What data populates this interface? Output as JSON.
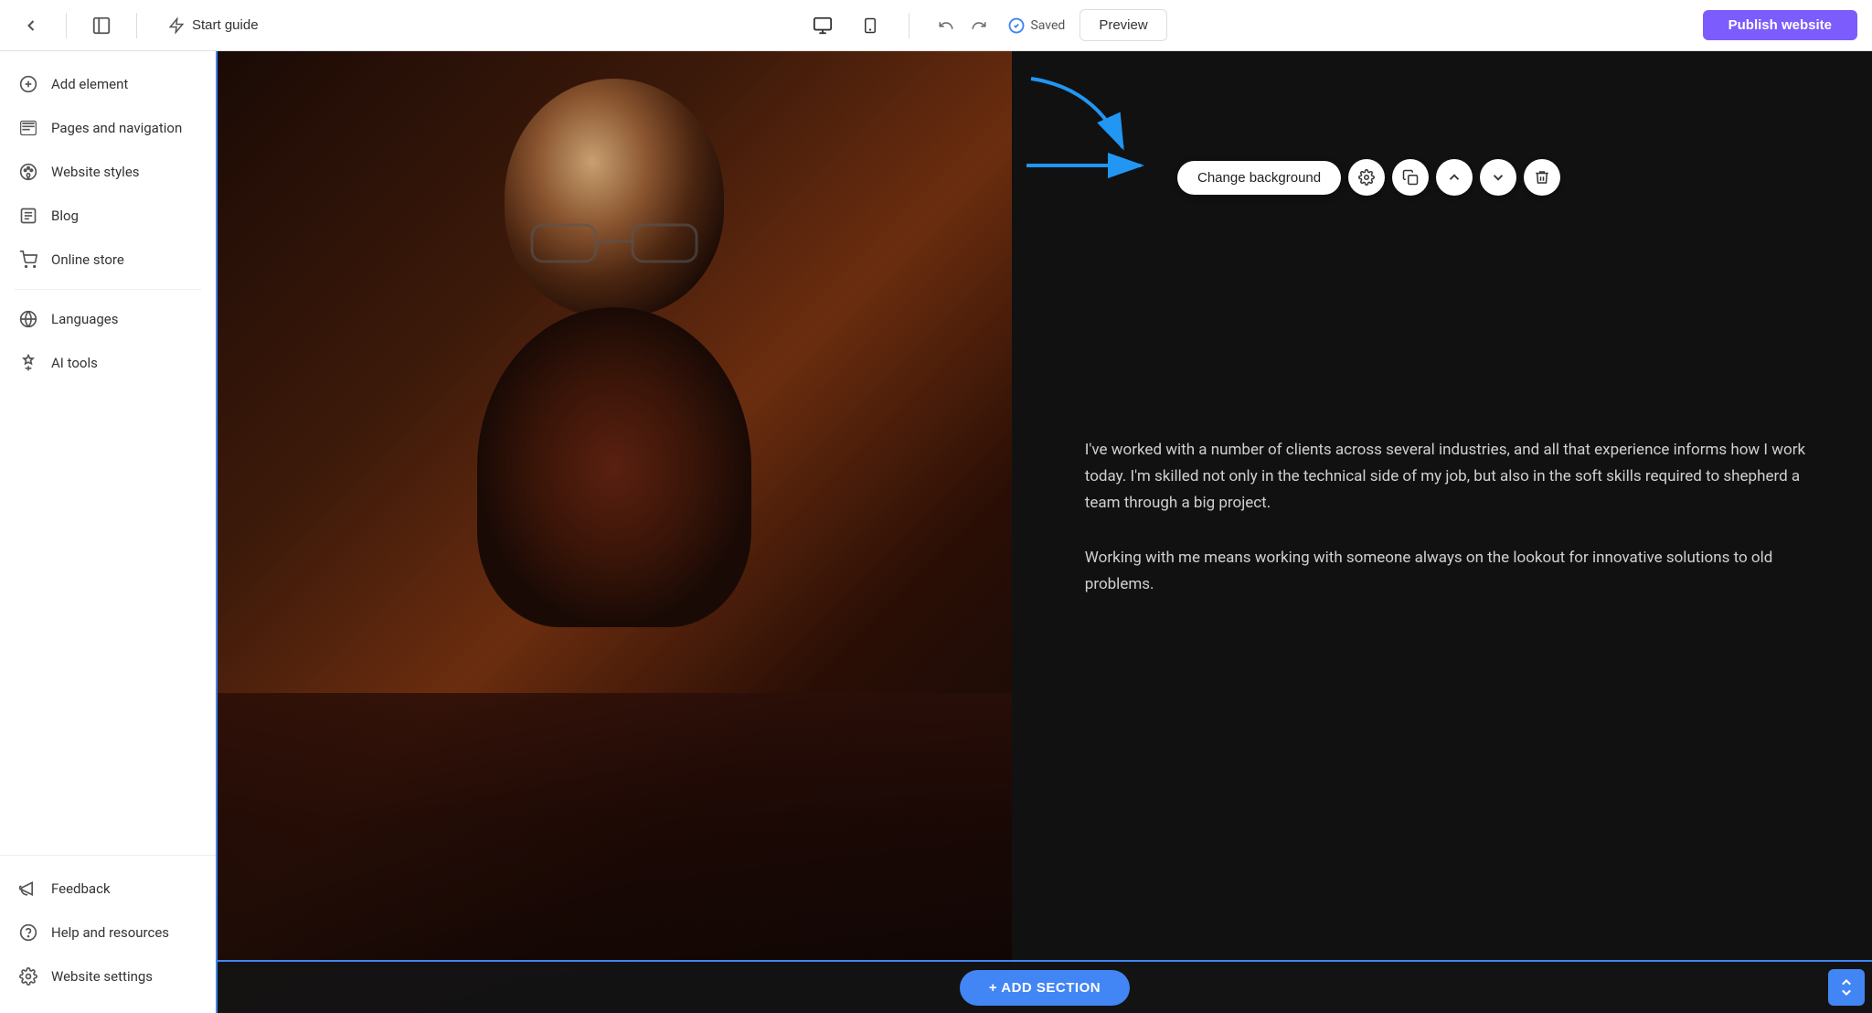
{
  "topbar": {
    "back_label": "←",
    "panel_toggle_label": "⊞",
    "start_guide_label": "Start guide",
    "device_desktop_label": "💻",
    "device_mobile_label": "📱",
    "undo_label": "↺",
    "redo_label": "↻",
    "saved_label": "Saved",
    "preview_label": "Preview",
    "publish_label": "Publish website"
  },
  "sidebar": {
    "items": [
      {
        "id": "add-element",
        "label": "Add element",
        "icon": "plus-circle"
      },
      {
        "id": "pages-navigation",
        "label": "Pages and navigation",
        "icon": "pages"
      },
      {
        "id": "website-styles",
        "label": "Website styles",
        "icon": "palette"
      },
      {
        "id": "blog",
        "label": "Blog",
        "icon": "blog"
      },
      {
        "id": "online-store",
        "label": "Online store",
        "icon": "cart"
      },
      {
        "id": "languages",
        "label": "Languages",
        "icon": "languages"
      },
      {
        "id": "ai-tools",
        "label": "AI tools",
        "icon": "ai"
      }
    ],
    "bottom_items": [
      {
        "id": "feedback",
        "label": "Feedback",
        "icon": "megaphone"
      },
      {
        "id": "help-resources",
        "label": "Help and resources",
        "icon": "question-circle"
      },
      {
        "id": "website-settings",
        "label": "Website settings",
        "icon": "gear"
      }
    ]
  },
  "section_toolbar": {
    "change_background_label": "Change background",
    "settings_icon": "gear",
    "copy_icon": "copy",
    "move_up_icon": "arrow-up",
    "move_down_icon": "arrow-down",
    "delete_icon": "trash"
  },
  "canvas": {
    "paragraph1": "I've worked with a number of clients across several industries, and all that experience informs how I work today. I'm skilled not only in the technical side of my job, but also in the soft skills required to shepherd a team through a big project.",
    "paragraph2": "Working with me means working with someone always on the lookout for innovative solutions to old problems."
  },
  "add_section": {
    "label": "+ ADD SECTION"
  },
  "colors": {
    "accent_blue": "#4285f4",
    "publish_purple": "#7c5cfc",
    "sidebar_border": "#4285f4"
  }
}
